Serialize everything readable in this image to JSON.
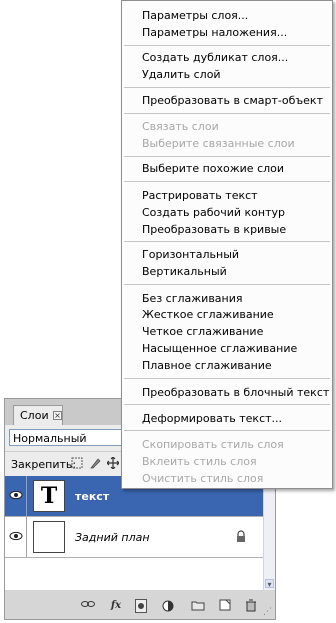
{
  "panel": {
    "tab_label": "Слои",
    "tab_close": "×",
    "blend_mode": "Нормальный",
    "lock_label": "Закрепить:",
    "layers": [
      {
        "name": "текст",
        "thumb": "T",
        "selected": true
      },
      {
        "name": "Задний план",
        "thumb": "",
        "selected": false
      }
    ],
    "bottom_icons": [
      "link-icon",
      "fx-icon",
      "mask-icon",
      "adjustment-icon",
      "folder-icon",
      "new-layer-icon",
      "trash-icon"
    ],
    "fx_label": "fx"
  },
  "menu": {
    "items": [
      {
        "label": "Параметры слоя...",
        "enabled": true
      },
      {
        "label": "Параметры наложения...",
        "enabled": true
      },
      {
        "label": "Создать дубликат слоя...",
        "enabled": true
      },
      {
        "label": "Удалить слой",
        "enabled": true
      },
      {
        "label": "Преобразовать в смарт-объект",
        "enabled": true
      },
      {
        "label": "Связать слои",
        "enabled": false
      },
      {
        "label": "Выберите связанные слои",
        "enabled": false
      },
      {
        "label": "Выберите похожие слои",
        "enabled": true
      },
      {
        "label": "Растрировать текст",
        "enabled": true
      },
      {
        "label": "Создать рабочий контур",
        "enabled": true
      },
      {
        "label": "Преобразовать в кривые",
        "enabled": true
      },
      {
        "label": "Горизонтальный",
        "enabled": true
      },
      {
        "label": "Вертикальный",
        "enabled": true
      },
      {
        "label": "Без сглаживания",
        "enabled": true
      },
      {
        "label": "Жесткое сглаживание",
        "enabled": true
      },
      {
        "label": "Четкое сглаживание",
        "enabled": true
      },
      {
        "label": "Насыщенное сглаживание",
        "enabled": true
      },
      {
        "label": "Плавное сглаживание",
        "enabled": true
      },
      {
        "label": "Преобразовать в блочный текст",
        "enabled": true
      },
      {
        "label": "Деформировать текст...",
        "enabled": true
      },
      {
        "label": "Скопировать стиль слоя",
        "enabled": false
      },
      {
        "label": "Вклеить стиль слоя",
        "enabled": false
      },
      {
        "label": "Очистить стиль слоя",
        "enabled": false
      }
    ]
  },
  "colors": {
    "selection": "#3a65b0",
    "disabled_text": "#a8a8a8"
  }
}
